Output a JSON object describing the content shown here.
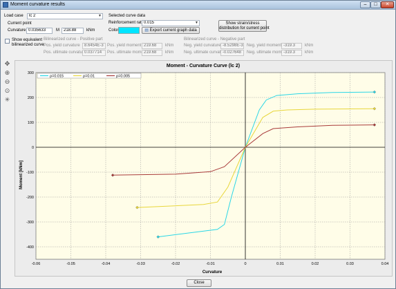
{
  "window": {
    "title": "Moment curvature results",
    "min_glyph": "–",
    "max_glyph": "□",
    "close_glyph": "✕"
  },
  "controls": {
    "load_case_label": "Load case",
    "load_case_value": "lc 2",
    "current_point_label": "Current point",
    "curvature_label": "Curvature",
    "curvature_value": "0.035633",
    "m_label": "M",
    "m_value": "218.88",
    "m_unit": "kNm",
    "selected_curve_label": "Selected curve data",
    "reinforcement_label": "Reinforcement ratio",
    "reinforcement_value": "0.015",
    "color_label": "Color",
    "color_value": "#00e5ff",
    "export_button": "Export current graph data",
    "strain_button_line1": "Show strain/stress",
    "strain_button_line2": "distribution for current point",
    "show_bilinear_line1": "Show equivalent",
    "show_bilinear_line2": "bilinearized curve"
  },
  "bilinear": {
    "pos_header": "Bilinearized curve - Positive part",
    "neg_header": "Bilinearized curve - Negative part",
    "pos_yield_curv_label": "Pos. yield curvature",
    "pos_yield_curv_value": "8.6454E-3",
    "pos_ult_curv_label": "Pos. ultimate curvature",
    "pos_ult_curv_value": "0.037714",
    "pos_yield_mom_label": "Pos. yield moment",
    "pos_yield_mom_value": "219.68",
    "pos_ult_mom_label": "Pos. ultimate moment",
    "pos_ult_mom_value": "219.68",
    "neg_yield_curv_label": "Neg. yield curvature",
    "neg_yield_curv_value": "-8.5298E-3",
    "neg_ult_curv_label": "Neg. ultimate curvature",
    "neg_ult_curv_value": "-0.027648",
    "neg_yield_mom_label": "Neg. yield moment",
    "neg_yield_mom_value": "-319.3",
    "neg_ult_mom_label": "Neg. ultimate moment",
    "neg_ult_mom_value": "-319.3",
    "unit": "kNm"
  },
  "toolbar": {
    "icons": [
      "pan-icon",
      "zoom-in-icon",
      "zoom-out-icon",
      "zoom-reset-icon",
      "select-point-icon"
    ],
    "camera_icon": "camera-icon"
  },
  "footer": {
    "close_button": "Close"
  },
  "chart_data": {
    "type": "line",
    "title": "Moment - Curvature Curve (lc 2)",
    "xlabel": "Curvature",
    "ylabel": "Moment [kNm]",
    "xlim": [
      -0.06,
      0.04
    ],
    "ylim": [
      -450,
      300
    ],
    "xticks": [
      "-0.06",
      "-0.05",
      "-0.04",
      "-0.03",
      "-0.02",
      "-0.01",
      "0",
      "0.01",
      "0.02",
      "0.03",
      "0.04"
    ],
    "xtick_values": [
      -0.06,
      -0.05,
      -0.04,
      -0.03,
      -0.02,
      -0.01,
      0,
      0.01,
      0.02,
      0.03,
      0.04
    ],
    "yticks": [
      "300",
      "200",
      "100",
      "0",
      "-100",
      "-200",
      "-300",
      "-400"
    ],
    "ytick_values": [
      300,
      200,
      100,
      0,
      -100,
      -200,
      -300,
      -400
    ],
    "grid": true,
    "legend_position": "top-left",
    "series": [
      {
        "name": "ρ=0.015",
        "color": "#29d6e6",
        "x": [
          -0.025,
          -0.008,
          -0.006,
          -0.004,
          0,
          0.004,
          0.006,
          0.009,
          0.015,
          0.025,
          0.037
        ],
        "y": [
          -360,
          -330,
          -310,
          -200,
          0,
          150,
          190,
          208,
          215,
          220,
          222
        ]
      },
      {
        "name": "ρ=0.01",
        "color": "#e8d63a",
        "x": [
          -0.031,
          -0.012,
          -0.008,
          -0.005,
          0,
          0.005,
          0.008,
          0.012,
          0.02,
          0.037
        ],
        "y": [
          -242,
          -230,
          -220,
          -160,
          0,
          120,
          145,
          150,
          153,
          155
        ]
      },
      {
        "name": "ρ=0.005",
        "color": "#a83a3a",
        "x": [
          -0.038,
          -0.02,
          -0.01,
          -0.008,
          -0.006,
          0,
          0.005,
          0.008,
          0.015,
          0.025,
          0.037
        ],
        "y": [
          -112,
          -108,
          -98,
          -88,
          -78,
          0,
          55,
          75,
          82,
          88,
          90
        ]
      }
    ]
  }
}
